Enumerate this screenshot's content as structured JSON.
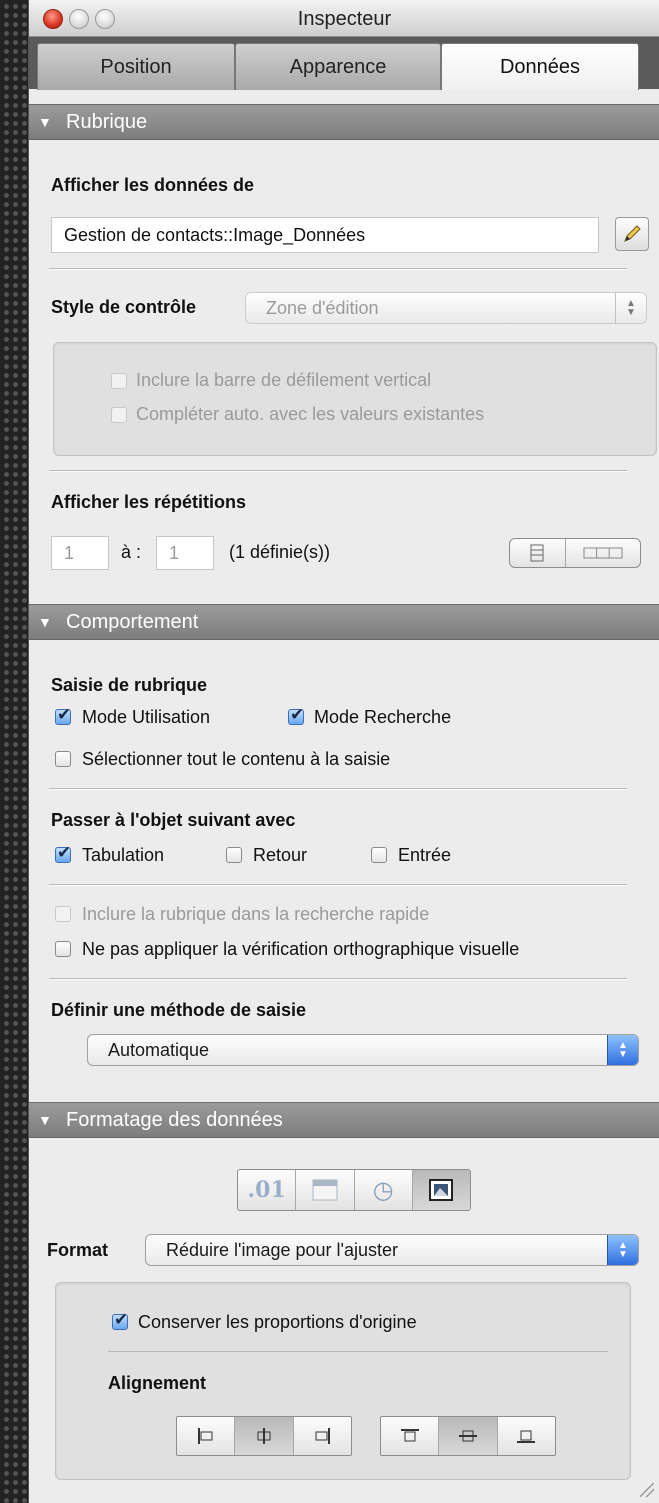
{
  "window": {
    "title": "Inspecteur"
  },
  "tabs": [
    {
      "label": "Position",
      "active": false
    },
    {
      "label": "Apparence",
      "active": false
    },
    {
      "label": "Données",
      "active": true
    }
  ],
  "rubrique": {
    "header": "Rubrique",
    "display_label": "Afficher les données de",
    "field_value": "Gestion de contacts::Image_Données",
    "control_style_label": "Style de contrôle",
    "control_style_value": "Zone d'édition",
    "opt_scrollbar": "Inclure la barre de défilement vertical",
    "opt_autocomplete": "Compléter auto. avec les valeurs existantes",
    "repetitions_label": "Afficher les répétitions",
    "rep_from": "1",
    "rep_to_label": "à :",
    "rep_to": "1",
    "rep_defined": "(1 définie(s))"
  },
  "comportement": {
    "header": "Comportement",
    "entry_label": "Saisie de rubrique",
    "mode_use": "Mode Utilisation",
    "mode_search": "Mode Recherche",
    "select_all": "Sélectionner tout le contenu à la saisie",
    "next_label": "Passer à l'objet suivant avec",
    "tab": "Tabulation",
    "return": "Retour",
    "enter": "Entrée",
    "quick_find": "Inclure la rubrique dans la recherche rapide",
    "no_spellcheck": "Ne pas appliquer la vérification orthographique visuelle",
    "input_method_label": "Définir une méthode de saisie",
    "input_method_value": "Automatique"
  },
  "formatage": {
    "header": "Formatage des données",
    "format_types": [
      {
        "icon": "number-format-icon",
        "glyph": ".01"
      },
      {
        "icon": "date-format-icon",
        "glyph": ""
      },
      {
        "icon": "time-format-icon",
        "glyph": "◷"
      },
      {
        "icon": "graphic-format-icon",
        "glyph": ""
      }
    ],
    "format_label": "Format",
    "format_value": "Réduire l'image pour l'ajuster",
    "keep_proportions": "Conserver les proportions d'origine",
    "alignment_label": "Alignement"
  },
  "colors": {
    "section_header": "#8a8a8a",
    "panel": "#ececec",
    "accent_blue": "#2f6fe0"
  }
}
